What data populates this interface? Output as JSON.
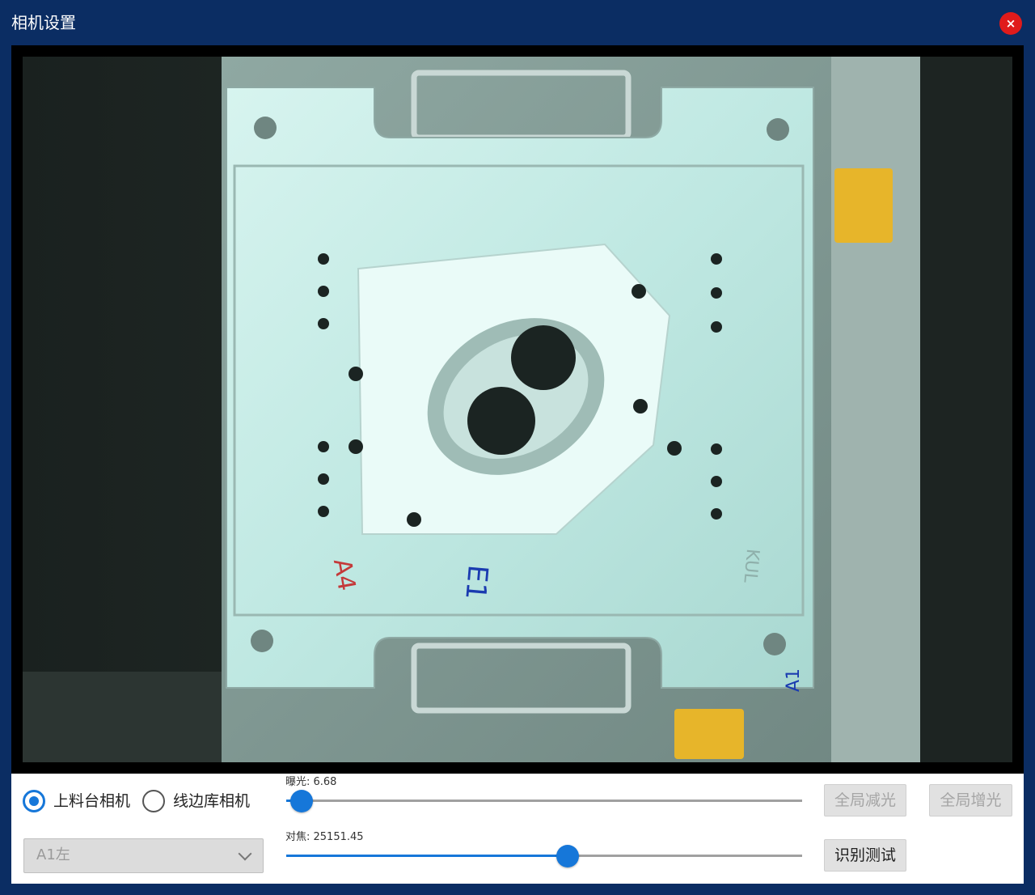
{
  "window": {
    "title": "相机设置",
    "close_label": "×"
  },
  "camera": {
    "source": {
      "options": [
        "上料台相机",
        "线边库相机"
      ],
      "selected": "上料台相机"
    },
    "station": {
      "value": "A1左"
    },
    "exposure": {
      "label": "曝光: 6.68",
      "value": 6.68,
      "position": 0.03
    },
    "focus": {
      "label": "对焦: 25151.45",
      "value": 25151.45,
      "position": 0.545
    },
    "buttons": {
      "global_decrease": "全局减光",
      "global_increase": "全局增光",
      "recognize_test": "识别测试"
    },
    "image_labels": {
      "left": "A4",
      "center": "E1",
      "bottom_right": "A1",
      "faint": "KUL"
    }
  }
}
